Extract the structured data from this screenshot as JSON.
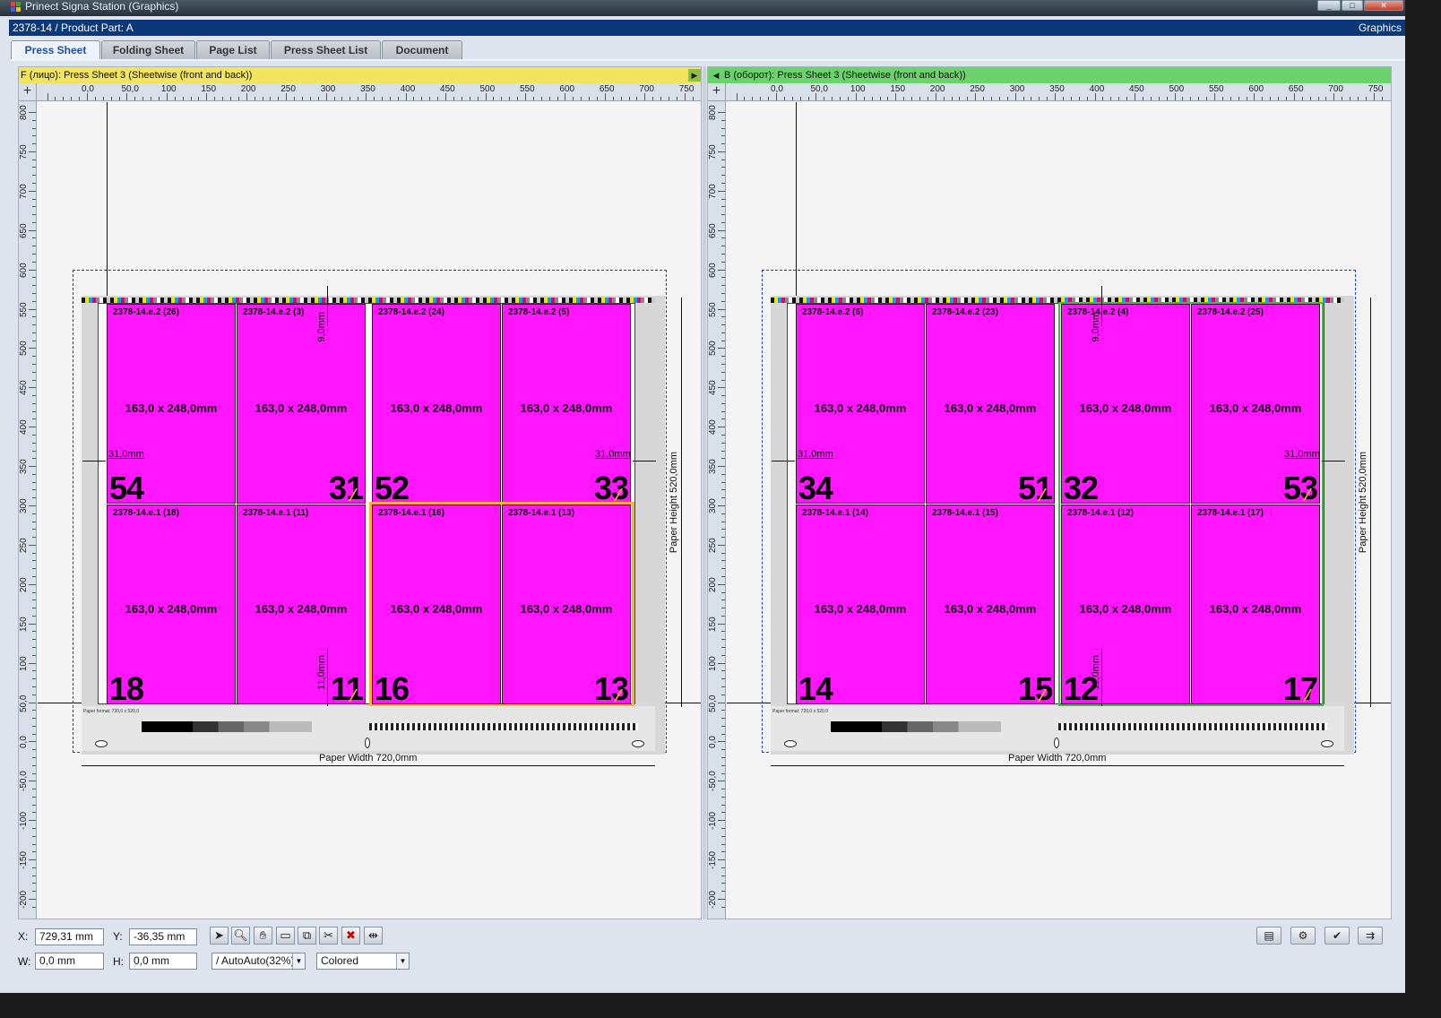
{
  "window": {
    "title": "Prinect Signa Station (Graphics)",
    "subtitle": "2378-14 / Product Part: A",
    "workspace": "Graphics"
  },
  "tabs": [
    {
      "label": "Press Sheet",
      "active": true
    },
    {
      "label": "Folding Sheet",
      "active": false
    },
    {
      "label": "Page List",
      "active": false
    },
    {
      "label": "Press Sheet List",
      "active": false
    },
    {
      "label": "Document",
      "active": false
    }
  ],
  "ruler": {
    "h_labels": [
      "0,0",
      "50,0",
      "100",
      "150",
      "200",
      "250",
      "300",
      "350",
      "400",
      "450",
      "500",
      "550",
      "600",
      "650",
      "700",
      "750"
    ],
    "v_labels": [
      "800",
      "750",
      "700",
      "650",
      "600",
      "550",
      "500",
      "450",
      "400",
      "350",
      "300",
      "250",
      "200",
      "150",
      "100",
      "50,0",
      "0,0",
      "-50,0",
      "-100",
      "-150",
      "-200"
    ]
  },
  "panes": [
    {
      "header": "F (лицо):  Press Sheet 3 (Sheetwise (front and back))",
      "header_color": "#f2e45e",
      "paper_width": "Paper Width 720,0mm",
      "paper_height": "Paper Height 520,0mm",
      "paper_format": "Paper format: 720,0 x 520,0",
      "dims": {
        "left": "31,0mm",
        "right": "31,0mm",
        "top": "9,0mm",
        "bottom": "11,0mm"
      },
      "pages": [
        {
          "name": "2378-14.e.2 (26)",
          "size": "163,0 x 248,0mm",
          "num": "54",
          "num_side": "l"
        },
        {
          "name": "2378-14.e.2 (3)",
          "size": "163,0 x 248,0mm",
          "num": "31",
          "num_side": "r"
        },
        {
          "name": "2378-14.e.2 (24)",
          "size": "163,0 x 248,0mm",
          "num": "52",
          "num_side": "l"
        },
        {
          "name": "2378-14.e.2 (5)",
          "size": "163,0 x 248,0mm",
          "num": "33",
          "num_side": "r"
        },
        {
          "name": "2378-14.e.1 (18)",
          "size": "163,0 x 248,0mm",
          "num": "18",
          "num_side": "l"
        },
        {
          "name": "2378-14.e.1 (11)",
          "size": "163,0 x 248,0mm",
          "num": "11",
          "num_side": "r"
        },
        {
          "name": "2378-14.e.1 (16)",
          "size": "163,0 x 248,0mm",
          "num": "16",
          "num_side": "l"
        },
        {
          "name": "2378-14.e.1 (13)",
          "size": "163,0 x 248,0mm",
          "num": "13",
          "num_side": "r"
        }
      ]
    },
    {
      "header": "B (оборот):  Press Sheet 3 (Sheetwise (front and back))",
      "header_color": "#6bd36b",
      "paper_width": "Paper Width 720,0mm",
      "paper_height": "Paper Height 520,0mm",
      "paper_format": "Paper format: 720,0 x 520,0",
      "dims": {
        "left": "31,0mm",
        "right": "31,0mm",
        "top": "9,0mm",
        "bottom": "11,0mm"
      },
      "pages": [
        {
          "name": "2378-14.e.2 (6)",
          "size": "163,0 x 248,0mm",
          "num": "34",
          "num_side": "l"
        },
        {
          "name": "2378-14.e.2 (23)",
          "size": "163,0 x 248,0mm",
          "num": "51",
          "num_side": "r"
        },
        {
          "name": "2378-14.e.2 (4)",
          "size": "163,0 x 248,0mm",
          "num": "32",
          "num_side": "l"
        },
        {
          "name": "2378-14.e.2 (25)",
          "size": "163,0 x 248,0mm",
          "num": "53",
          "num_side": "r"
        },
        {
          "name": "2378-14.e.1 (14)",
          "size": "163,0 x 248,0mm",
          "num": "14",
          "num_side": "l"
        },
        {
          "name": "2378-14.e.1 (15)",
          "size": "163,0 x 248,0mm",
          "num": "15",
          "num_side": "r"
        },
        {
          "name": "2378-14.e.1 (12)",
          "size": "163,0 x 248,0mm",
          "num": "12",
          "num_side": "l"
        },
        {
          "name": "2378-14.e.1 (17)",
          "size": "163,0 x 248,0mm",
          "num": "17",
          "num_side": "r"
        }
      ]
    }
  ],
  "status": {
    "x_label": "X:",
    "x_value": "729,31 mm",
    "y_label": "Y:",
    "y_value": "-36,35 mm",
    "w_label": "W:",
    "w_value": "0,0 mm",
    "h_label": "H:",
    "h_value": "0,0 mm",
    "zoom": "/ AutoAuto(32%)",
    "color_mode": "Colored"
  },
  "tools": [
    "select-arrow-icon",
    "zoom-icon",
    "hand-icon",
    "frame-icon",
    "copy-icon",
    "crop-icon",
    "delete-icon",
    "distribute-icon"
  ],
  "right_tools": [
    "fit-view-icon",
    "settings-icon",
    "check-icon",
    "output-icon"
  ]
}
